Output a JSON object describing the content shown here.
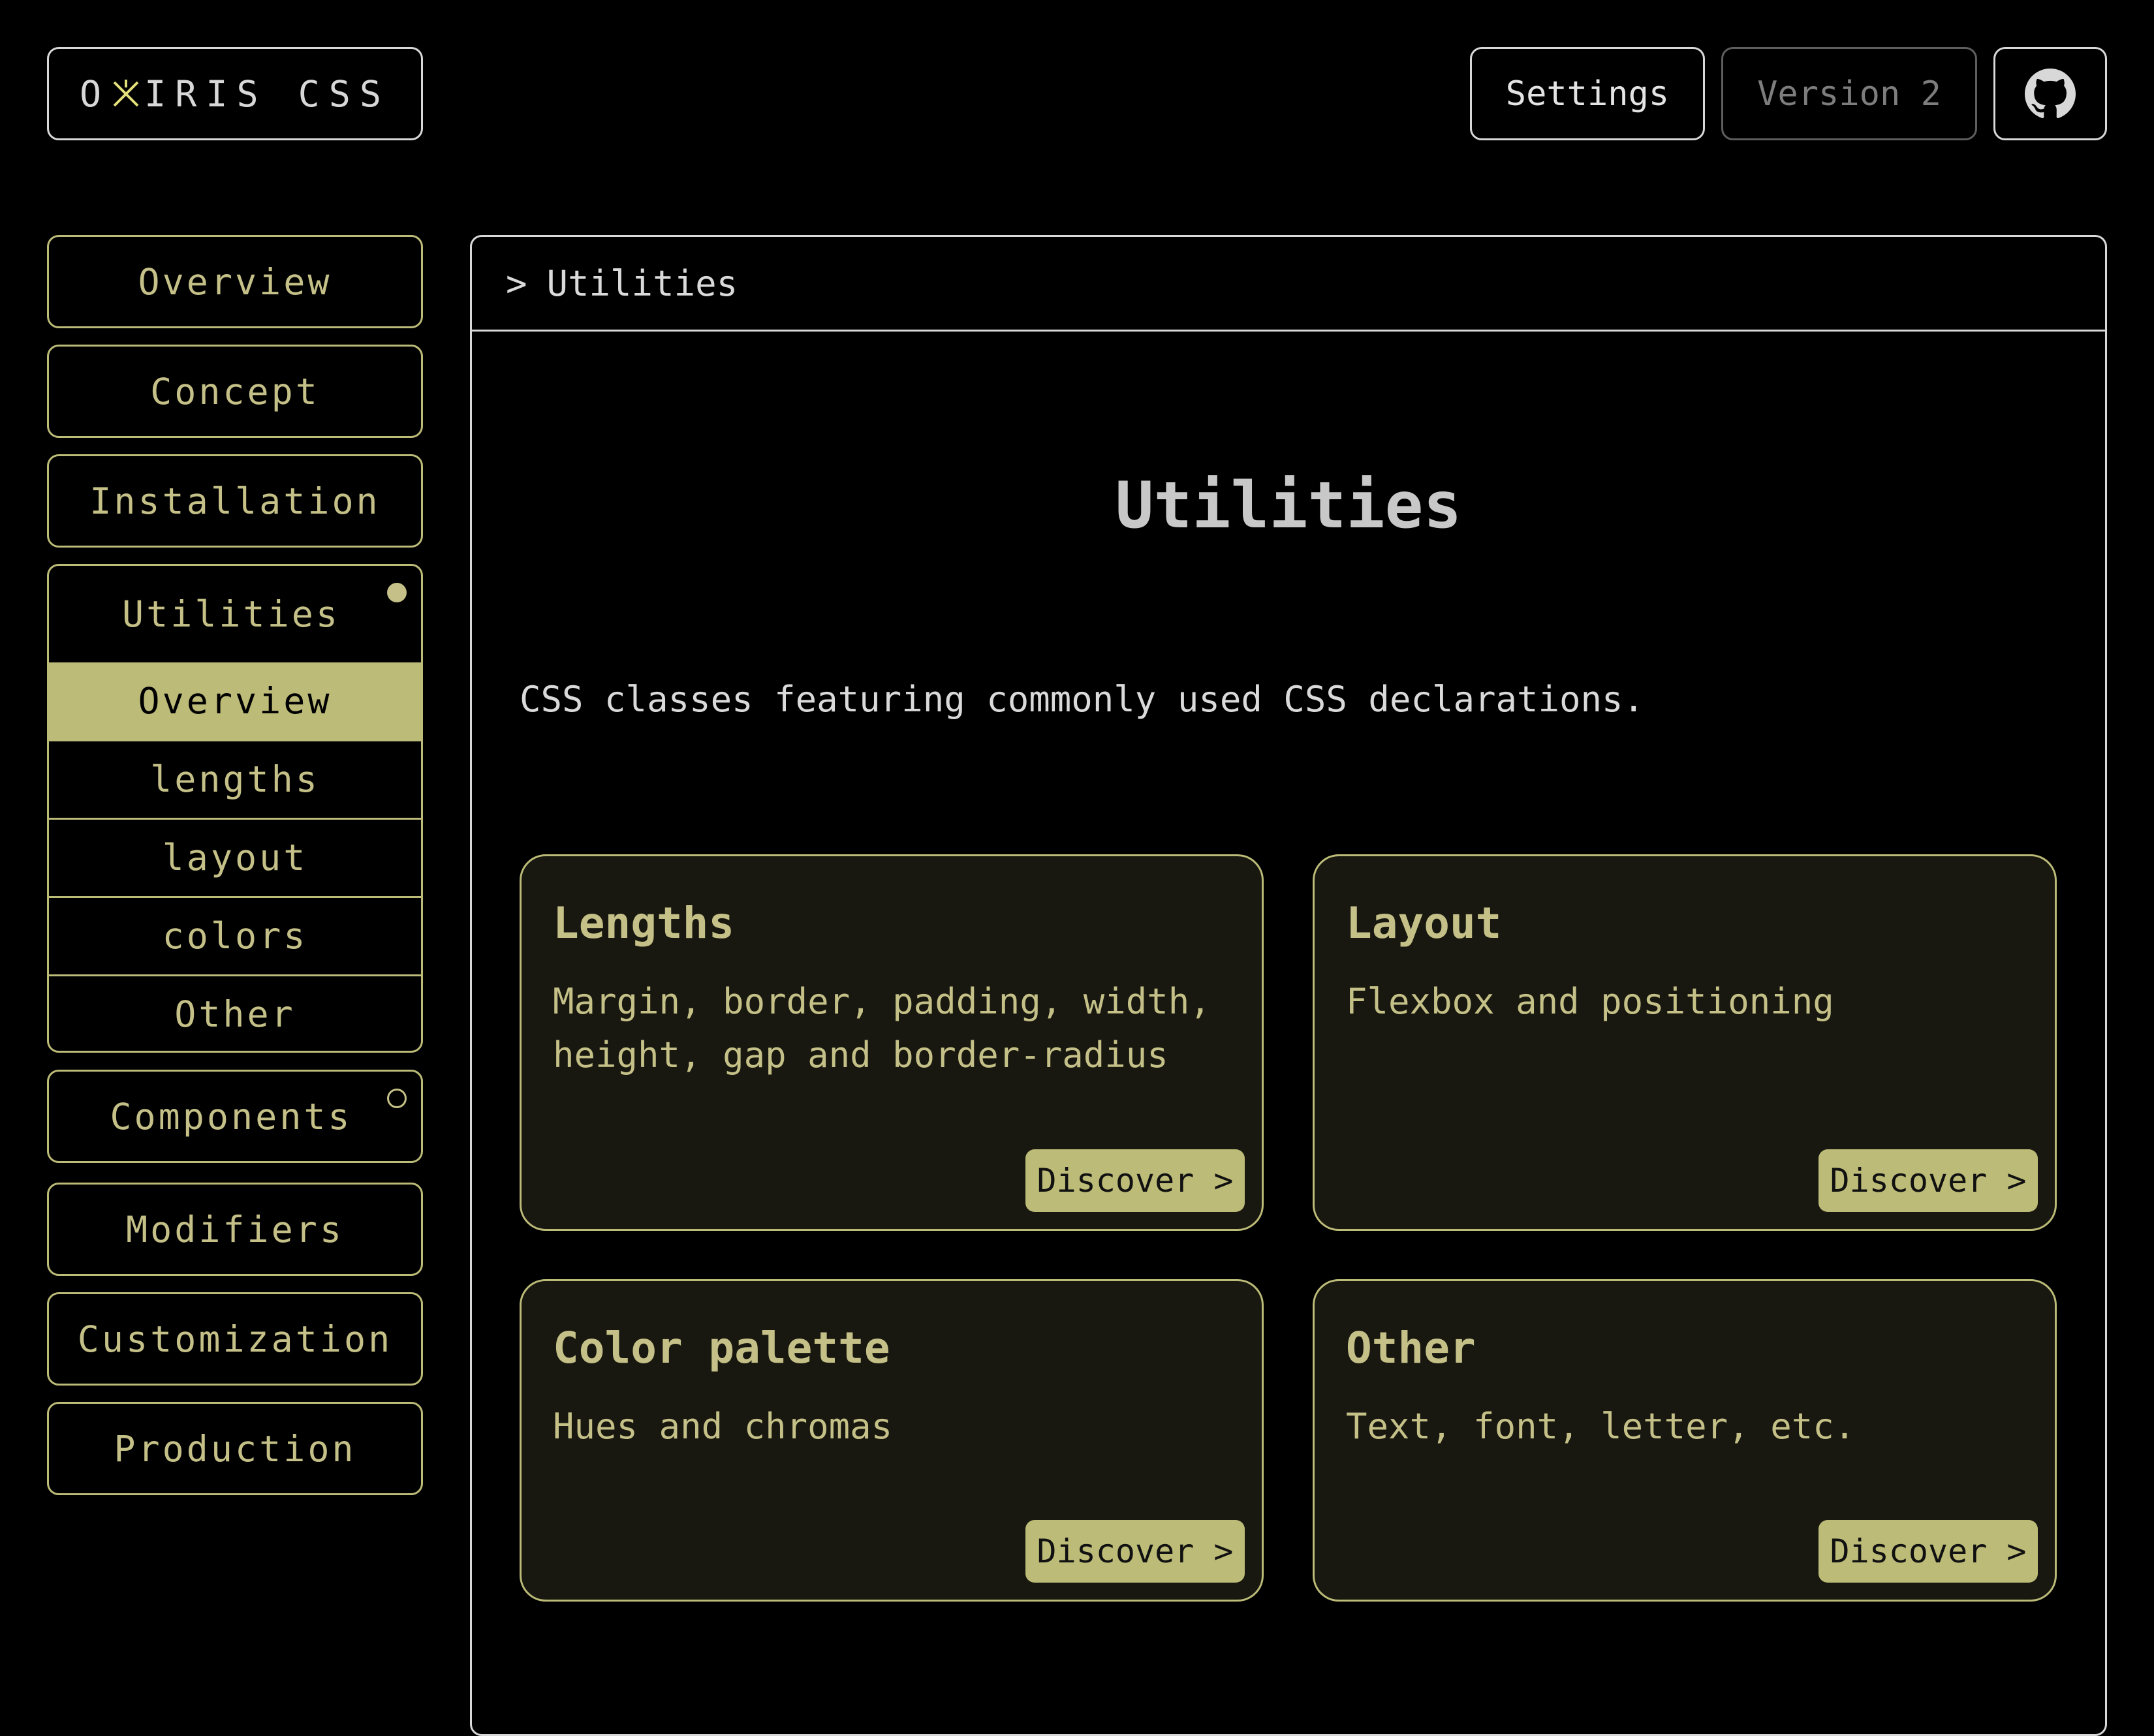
{
  "header": {
    "logo_prefix": "O",
    "logo_suffix": "IRIS CSS",
    "settings_label": "Settings",
    "version_label": "Version 2",
    "github_icon": "github-icon"
  },
  "sidebar": {
    "items": [
      {
        "label": "Overview"
      },
      {
        "label": "Concept"
      },
      {
        "label": "Installation"
      }
    ],
    "utilities": {
      "label": "Utilities",
      "sub_items": [
        {
          "label": "Overview",
          "active": true
        },
        {
          "label": "lengths"
        },
        {
          "label": "layout"
        },
        {
          "label": "colors"
        },
        {
          "label": "Other"
        }
      ]
    },
    "components_label": "Components",
    "after_items": [
      {
        "label": "Modifiers"
      },
      {
        "label": "Customization"
      },
      {
        "label": "Production"
      }
    ]
  },
  "main": {
    "breadcrumb_chevron": ">",
    "breadcrumb": "Utilities",
    "title": "Utilities",
    "description": "CSS classes featuring commonly used CSS declarations.",
    "cards": [
      {
        "title": "Lengths",
        "text": "Margin, border, padding, width, height, gap and border-radius",
        "button": "Discover >"
      },
      {
        "title": "Layout",
        "text": "Flexbox and positioning",
        "button": "Discover >"
      },
      {
        "title": "Color palette",
        "text": "Hues and chromas",
        "button": "Discover >"
      },
      {
        "title": "Other",
        "text": "Text, font, letter, etc.",
        "button": "Discover >"
      }
    ]
  },
  "colors": {
    "accent": "#bcbb78",
    "background": "#000000",
    "card_bg": "#181810",
    "text_light": "#dadada"
  }
}
